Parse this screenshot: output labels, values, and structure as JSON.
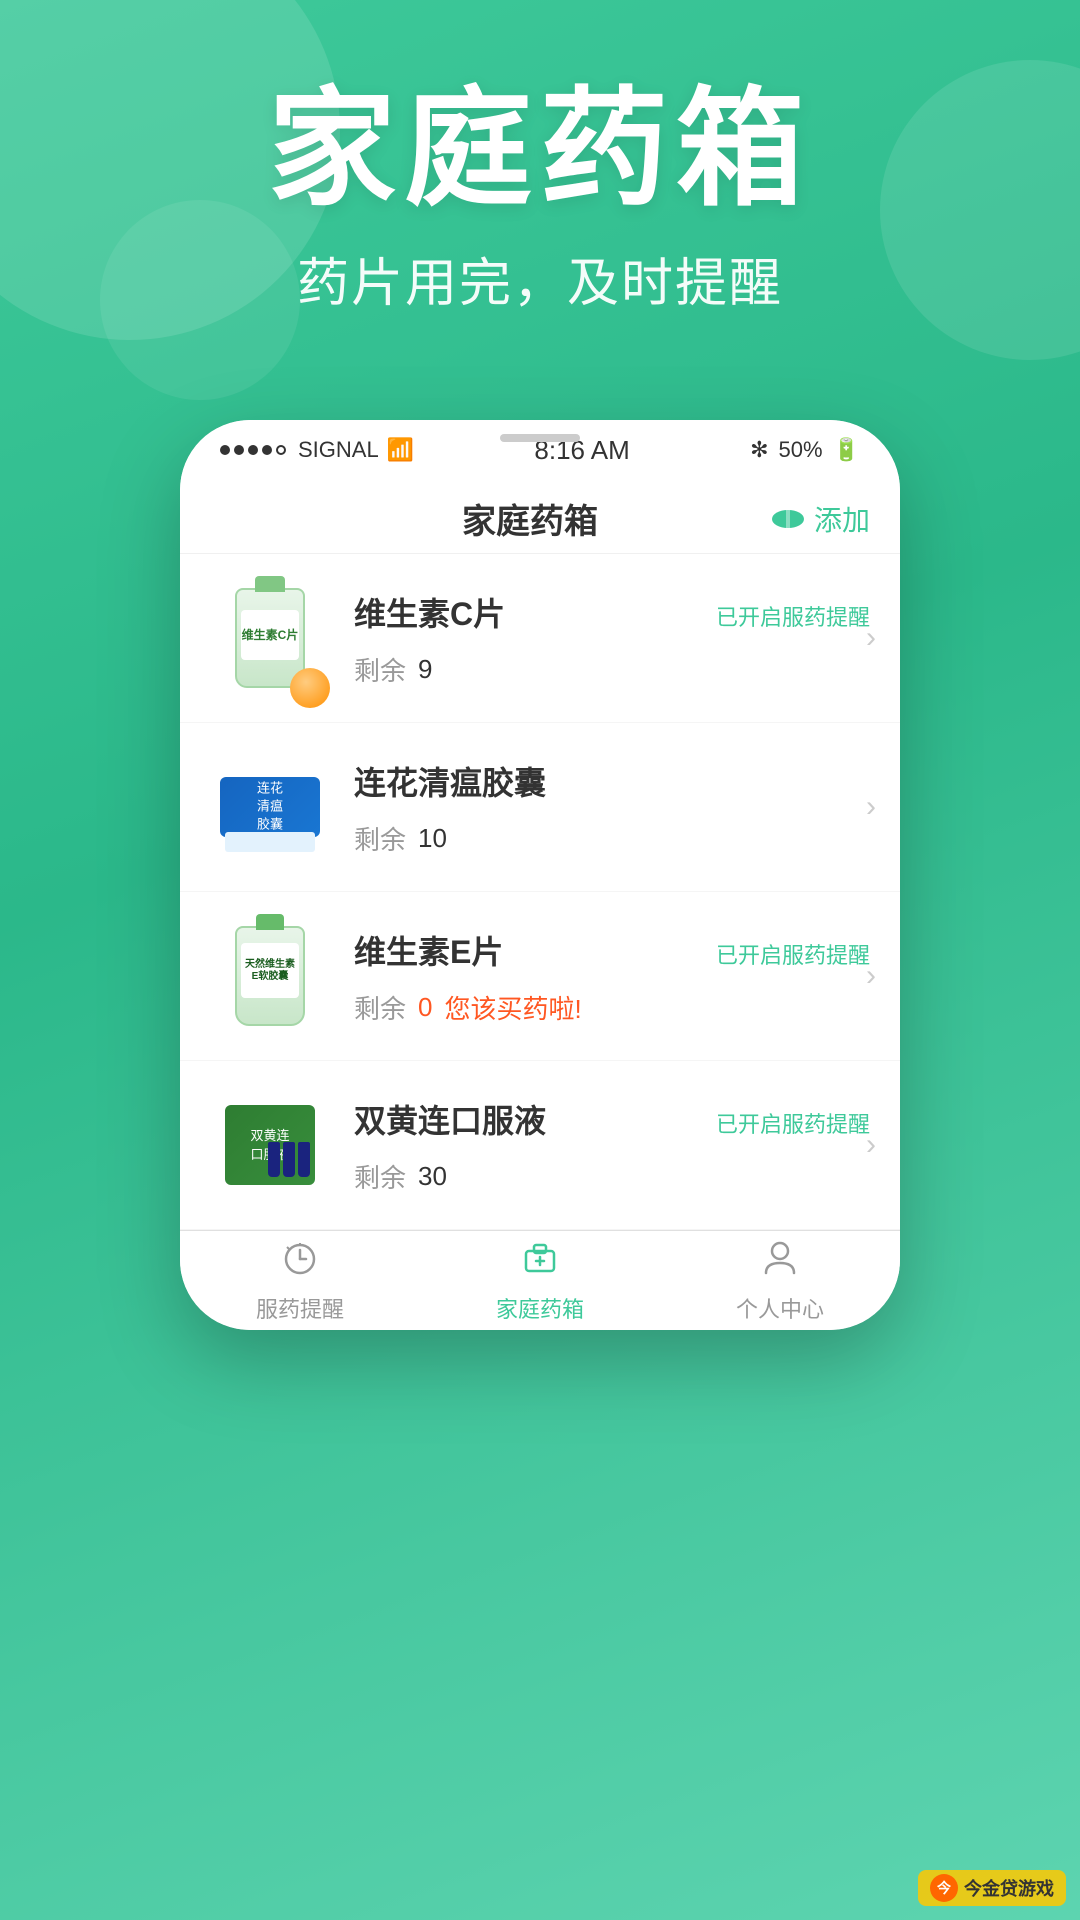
{
  "app": {
    "background_color": "#3EC99A",
    "hero_title": "家庭药箱",
    "hero_subtitle": "药片用完，及时提醒"
  },
  "status_bar": {
    "signal_text": "SIGNAL",
    "time": "8:16 AM",
    "battery_percent": "50%",
    "bluetooth": "✻"
  },
  "navbar": {
    "title": "家庭药箱",
    "add_label": "添加"
  },
  "medicines": [
    {
      "id": "vitamin-c",
      "name": "维生素C片",
      "reminder": "已开启服药提醒",
      "count_label": "剩余",
      "count": "9",
      "warning": false,
      "warning_text": ""
    },
    {
      "id": "lianhua",
      "name": "连花清瘟胶囊",
      "reminder": "",
      "count_label": "剩余",
      "count": "10",
      "warning": false,
      "warning_text": ""
    },
    {
      "id": "vitamin-e",
      "name": "维生素E片",
      "reminder": "已开启服药提醒",
      "count_label": "剩余",
      "count": "0",
      "warning": true,
      "warning_text": "您该买药啦!"
    },
    {
      "id": "shuanghuanglian",
      "name": "双黄连口服液",
      "reminder": "已开启服药提醒",
      "count_label": "剩余",
      "count": "30",
      "warning": false,
      "warning_text": ""
    }
  ],
  "bottom_nav": {
    "items": [
      {
        "id": "reminder",
        "label": "服药提醒",
        "icon": "⏰",
        "active": false
      },
      {
        "id": "medicine-box",
        "label": "家庭药箱",
        "icon": "💊",
        "active": true
      },
      {
        "id": "profile",
        "label": "个人中心",
        "icon": "👤",
        "active": false
      }
    ]
  },
  "watermark": {
    "text": "今金贷游戏",
    "logo": "今"
  }
}
